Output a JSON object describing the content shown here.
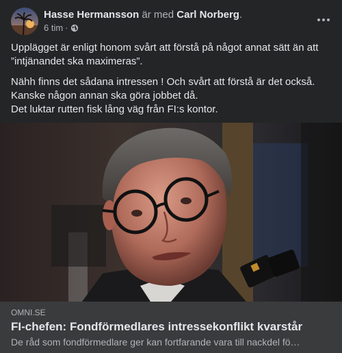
{
  "post": {
    "author": "Hasse Hermansson",
    "connector": "är med",
    "tagged": "Carl Norberg",
    "tagged_suffix": ".",
    "time": "6 tim",
    "time_sep": "·",
    "privacy_icon": "globe-icon",
    "more_icon": "more-options-icon",
    "paragraphs": [
      "Upplägget är enligt honom svårt att förstå på något annat sätt än att\n”intjänandet ska maximeras”.",
      "Nähh finns det sådana intressen ! Och svårt att förstå är det också.\nKanske någon annan ska göra jobbet då.\nDet luktar rutten fisk lång väg från FI:s kontor."
    ]
  },
  "link": {
    "domain": "OMNI.SE",
    "title": "FI-chefen: Fondförmedlares intressekonflikt kvarstår",
    "description": "De råd som fondförmedlare ger kan fortfarande vara till nackdel fö…"
  },
  "colors": {
    "background": "#242526",
    "card": "#3a3b3c",
    "text_primary": "#e4e6eb",
    "text_secondary": "#b0b3b8"
  }
}
